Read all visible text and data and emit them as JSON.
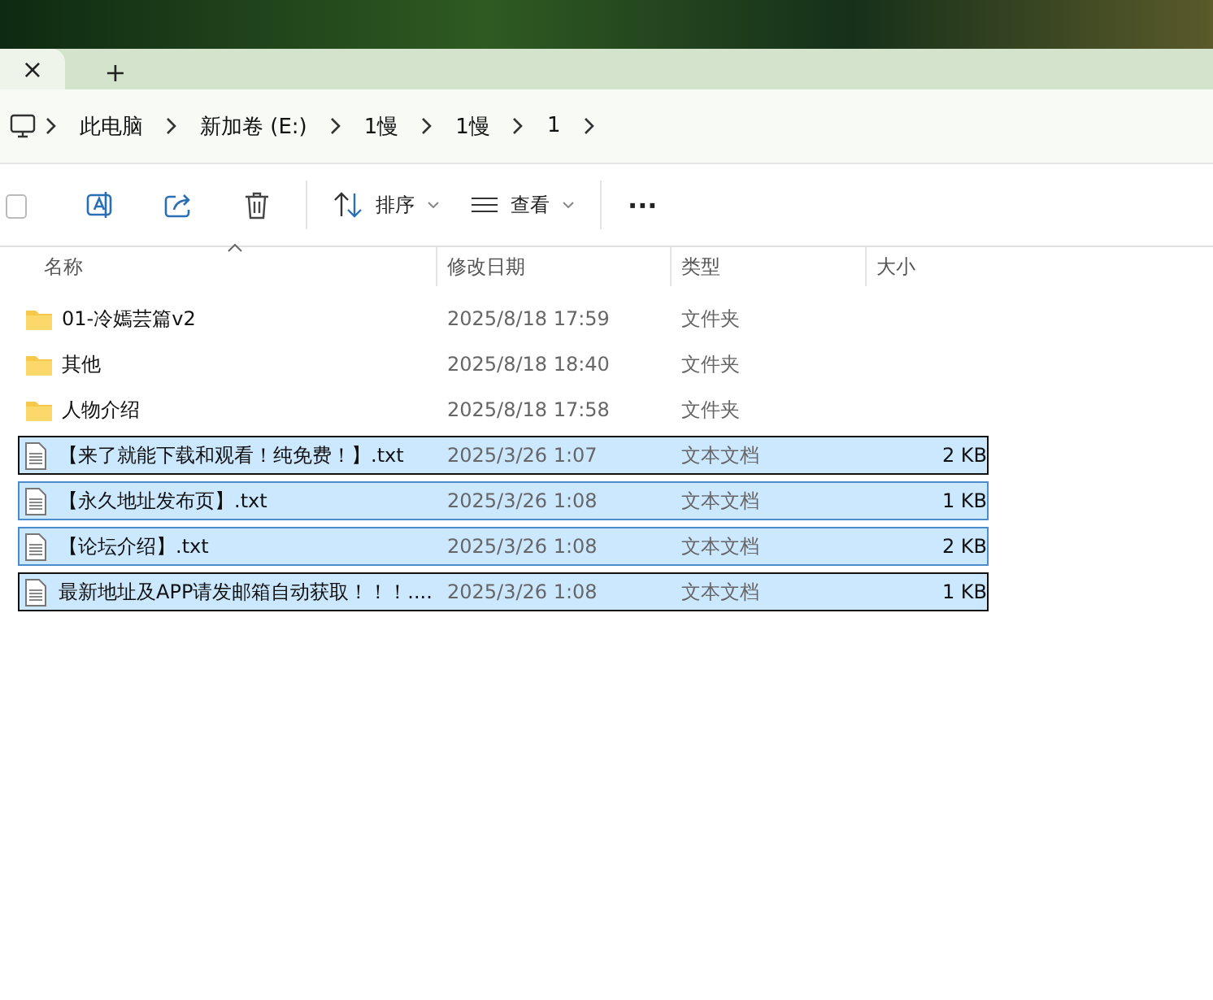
{
  "tabs": [
    {
      "kind": "tab",
      "label": "×",
      "selected": true
    },
    {
      "kind": "new",
      "label": "+",
      "selected": false
    }
  ],
  "breadcrumb": [
    "此电脑",
    "新加卷 (E:)",
    "1慢",
    "1慢",
    "1"
  ],
  "toolbar": {
    "sort": "排序",
    "view": "查看",
    "more": "···"
  },
  "columns": [
    "名称",
    "修改日期",
    "类型",
    "大小"
  ],
  "rows": [
    {
      "kind": "folder",
      "name": "01-冷嫣芸篇v2",
      "date": "2025/8/18 17:59",
      "type": "文件夹",
      "size": "",
      "selected": false,
      "focused": false
    },
    {
      "kind": "folder",
      "name": "其他",
      "date": "2025/8/18 18:40",
      "type": "文件夹",
      "size": "",
      "selected": false,
      "focused": false
    },
    {
      "kind": "folder",
      "name": "人物介绍",
      "date": "2025/8/18 17:58",
      "type": "文件夹",
      "size": "",
      "selected": false,
      "focused": false
    },
    {
      "kind": "file",
      "name": "【来了就能下载和观看！纯免费！】.txt",
      "date": "2025/3/26 1:07",
      "type": "文本文档",
      "size": "2 KB",
      "selected": true,
      "focused": true
    },
    {
      "kind": "file",
      "name": "【永久地址发布页】.txt",
      "date": "2025/3/26 1:08",
      "type": "文本文档",
      "size": "1 KB",
      "selected": true,
      "focused": false
    },
    {
      "kind": "file",
      "name": "【论坛介绍】.txt",
      "date": "2025/3/26 1:08",
      "type": "文本文档",
      "size": "2 KB",
      "selected": true,
      "focused": false
    },
    {
      "kind": "file",
      "name": "最新地址及APP请发邮箱自动获取！！！....",
      "date": "2025/3/26 1:08",
      "type": "文本文档",
      "size": "1 KB",
      "selected": true,
      "focused": true
    }
  ]
}
